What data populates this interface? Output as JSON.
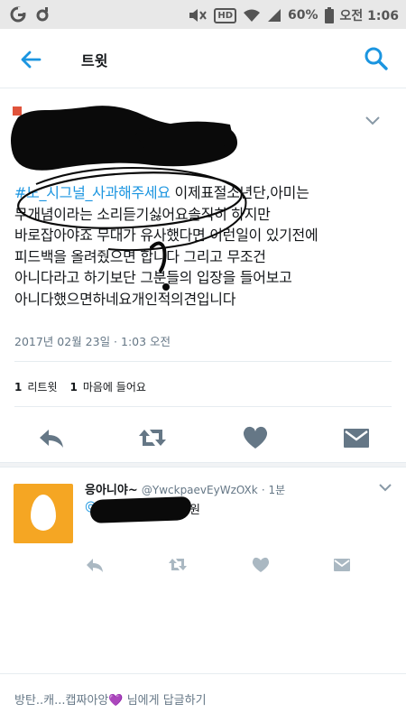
{
  "status_bar": {
    "battery": "60%",
    "time": "오전 1:06",
    "hd_label": "HD",
    "icons": [
      "g-icon",
      "settings-small-icon",
      "mute-icon",
      "hd-icon",
      "wifi-icon",
      "signal-icon",
      "battery-icon"
    ]
  },
  "app_bar": {
    "title": "트윗",
    "back_icon": "back-arrow-icon",
    "search_icon": "search-icon"
  },
  "tweet": {
    "hashtag": "#노_시그널_사과해주세요",
    "text_after_hashtag": " 이제표절소년단,아미는",
    "lines": [
      "무개념이라는 소리듣기싫어요솔직히 하지만",
      "바로잡아야죠 무대가 유사했다면 이런일이 있기전에",
      "피드백을 올려줬으면 합니다 그리고 무조건",
      "아니다라고 하기보단 그분들의 입장을 들어보고",
      "아니다했으면하네요개인적의견입니다"
    ],
    "timestamp": "2017년 02월 23일 · 1:03 오전",
    "retweet_count": "1",
    "retweet_label": "리트윗",
    "like_count": "1",
    "like_label": "마음에 들어요"
  },
  "reply": {
    "name": "응아니야~",
    "handle": "@YwckpaevEyWzOXk",
    "time": "· 1분",
    "mention_suffix": "원"
  },
  "reply_bar": {
    "prefix": "방탄..캐...캡짜아앙",
    "heart": "💜",
    "suffix": " 님에게 답글하기"
  },
  "colors": {
    "accent": "#1b95e0",
    "icon_gray": "#657786",
    "egg_bg": "#f5a623"
  }
}
